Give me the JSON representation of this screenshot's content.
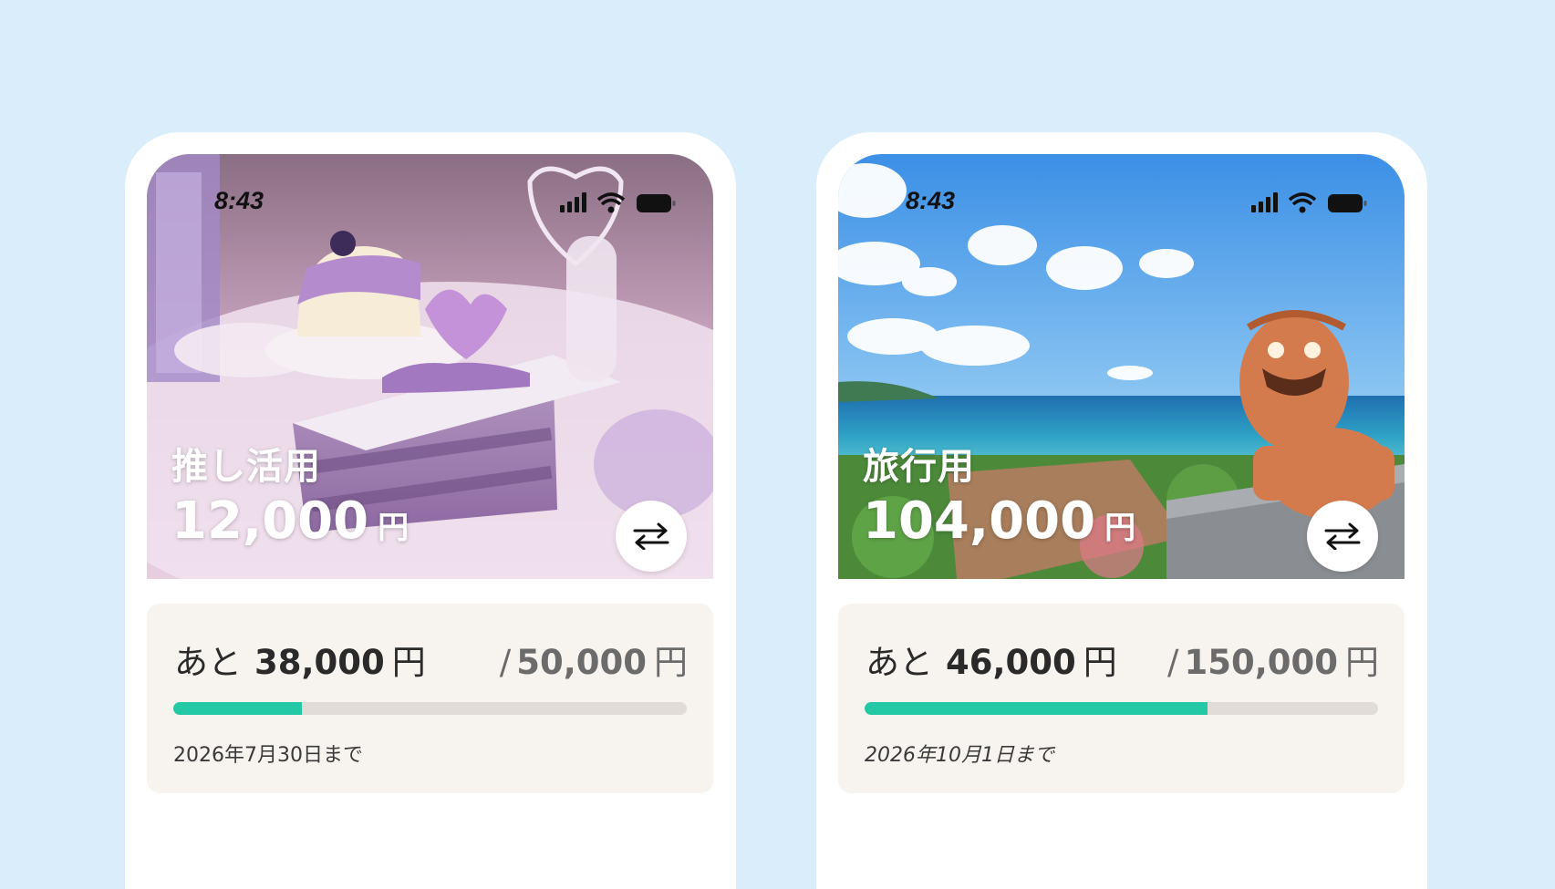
{
  "cards": [
    {
      "status_time": "8:43",
      "title": "推し活用",
      "balance": "12,000",
      "currency": "円",
      "remaining_prefix": "あと",
      "remaining": "38,000",
      "remaining_unit": "円",
      "target_slash": "/",
      "target": "50,000",
      "target_unit": "円",
      "progress": 0.25,
      "deadline": "2026年7月30日まで",
      "progress_color": "#22c9a4"
    },
    {
      "status_time": "8:43",
      "title": "旅行用",
      "balance": "104,000",
      "currency": "円",
      "remaining_prefix": "あと",
      "remaining": "46,000",
      "remaining_unit": "円",
      "target_slash": "/",
      "target": "150,000",
      "target_unit": "円",
      "progress": 0.667,
      "deadline": "2026年10月1日まで",
      "progress_color": "#22c9a4"
    }
  ],
  "icons": {
    "swap": "swap-arrows-icon",
    "signal": "cellular-signal-icon",
    "wifi": "wifi-icon",
    "battery": "battery-icon"
  },
  "colors": {
    "background": "#d9eefa",
    "accent": "#22c9a4"
  }
}
